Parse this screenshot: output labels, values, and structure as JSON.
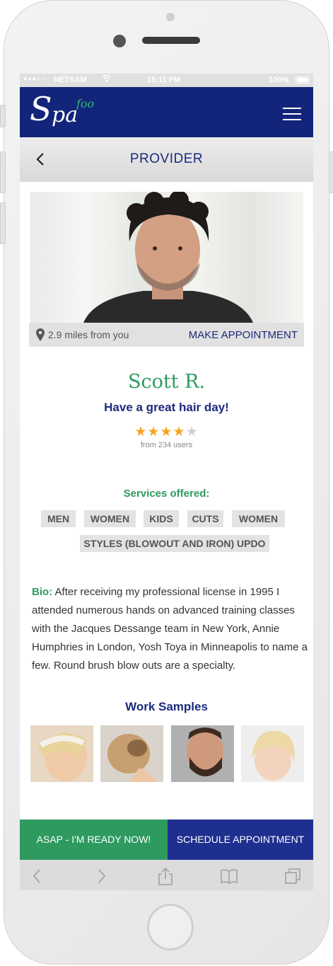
{
  "status_bar": {
    "carrier": "NETSAM",
    "time": "15:11 PM",
    "battery": "100%"
  },
  "app": {
    "logo_main_s": "S",
    "logo_main_pa": "pa",
    "logo_accent": "foo"
  },
  "nav": {
    "title": "PROVIDER"
  },
  "provider": {
    "distance": "2.9 miles from you",
    "make_appointment": "MAKE APPOINTMENT",
    "name": "Scott R.",
    "tagline": "Have a great hair day!",
    "rating": 4,
    "rating_max": 5,
    "reviews": "from 234 users"
  },
  "services": {
    "title": "Services offered:",
    "tags": [
      "MEN",
      "WOMEN",
      "KIDS",
      "CUTS",
      "WOMEN",
      "STYLES (BLOWOUT AND IRON) UPDO"
    ]
  },
  "bio": {
    "label": "Bio:",
    "text": "After receiving my professional license in 1995 I attended numerous hands on advanced training classes with the Jacques Dessange  team in New York, Annie Humphries in London, Yosh Toya in Minneapolis to name a few. Round brush blow outs are a specialty."
  },
  "work_samples": {
    "title": "Work Samples"
  },
  "actions": {
    "asap": "ASAP - I'M READY NOW!",
    "schedule": "SCHEDULE APPOINTMENT"
  },
  "colors": {
    "brand": "#13257a",
    "accent": "#2e9a60",
    "star": "#f4a622"
  }
}
